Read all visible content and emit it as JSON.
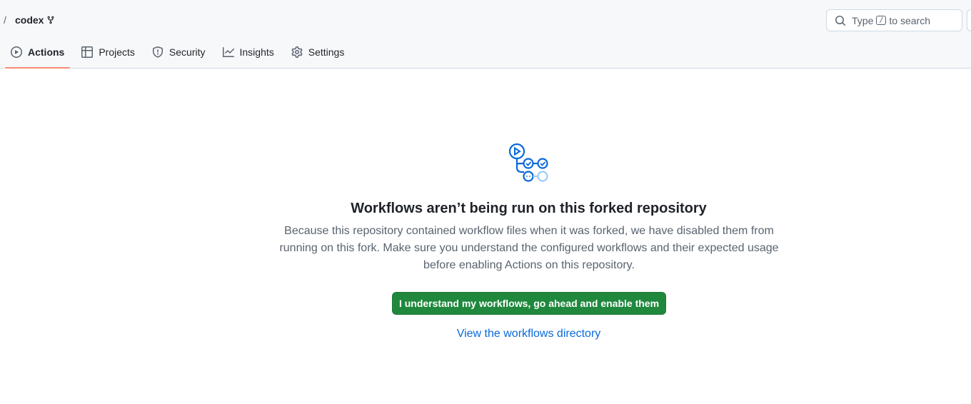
{
  "breadcrumb": {
    "separator": "/",
    "repo": "codex"
  },
  "search": {
    "prefix": "Type",
    "key": "/",
    "suffix": "to search"
  },
  "tabs": [
    {
      "label": "Actions",
      "icon": "play-icon",
      "selected": true
    },
    {
      "label": "Projects",
      "icon": "table-icon",
      "selected": false
    },
    {
      "label": "Security",
      "icon": "shield-icon",
      "selected": false
    },
    {
      "label": "Insights",
      "icon": "graph-icon",
      "selected": false
    },
    {
      "label": "Settings",
      "icon": "gear-icon",
      "selected": false
    }
  ],
  "notice": {
    "title": "Workflows aren’t being run on this forked repository",
    "description": "Because this repository contained workflow files when it was forked, we have disabled them from running on this fork. Make sure you understand the configured workflows and their expected usage before enabling Actions on this repository.",
    "enable_button": "I understand my workflows, go ahead and enable them",
    "directory_link": "View the workflows directory"
  },
  "colors": {
    "accent_green": "#1f883d",
    "link_blue": "#0969da",
    "tab_underline": "#fd8c73",
    "icon_blue": "#0969da"
  }
}
